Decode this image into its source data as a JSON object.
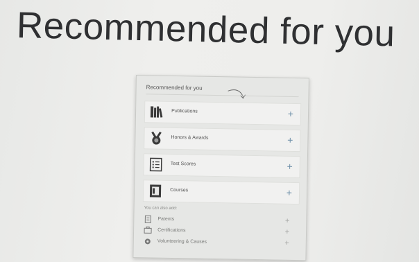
{
  "headline": "Recommended for you",
  "panel": {
    "title": "Recommended for you",
    "items": [
      {
        "label": "Publications",
        "icon": "books-icon",
        "action": "+"
      },
      {
        "label": "Honors & Awards",
        "icon": "medal-icon",
        "action": "+"
      },
      {
        "label": "Test Scores",
        "icon": "checklist-icon",
        "action": "+"
      },
      {
        "label": "Courses",
        "icon": "course-book-icon",
        "action": "+"
      }
    ],
    "also_label": "You can also add:",
    "also_items": [
      {
        "label": "Patents",
        "icon": "document-icon",
        "action": "+"
      },
      {
        "label": "Certifications",
        "icon": "certificate-icon",
        "action": "+"
      },
      {
        "label": "Volunteering & Causes",
        "icon": "volunteer-icon",
        "action": "+"
      }
    ]
  },
  "colors": {
    "accent": "#6d8fa8",
    "text": "#555555",
    "card_bg": "#e6e7e5"
  }
}
